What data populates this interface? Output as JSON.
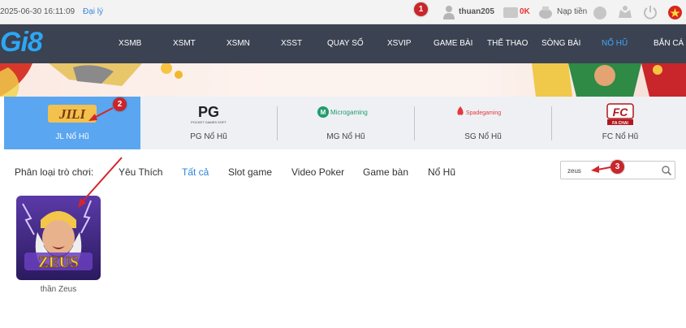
{
  "topbar": {
    "datetime": "2025-06-30 16:11:09",
    "lang_link": "Đại lý",
    "username": "thuan205",
    "balance": "0K",
    "deposit_label": "Nạp tiền",
    "icons": [
      "user-icon",
      "wallet-icon",
      "deposit-icon",
      "mail-icon",
      "vip-icon",
      "power-icon",
      "flag-icon"
    ]
  },
  "navbar": {
    "logo": "Gi8",
    "items": [
      {
        "label": "XSMB"
      },
      {
        "label": "XSMT"
      },
      {
        "label": "XSMN"
      },
      {
        "label": "XSST"
      },
      {
        "label": "QUAY SỐ"
      },
      {
        "label": "XSVIP"
      },
      {
        "label": "GAME BÀI"
      },
      {
        "label": "THỂ THAO"
      },
      {
        "label": "SÒNG BÀI"
      },
      {
        "label": "NỔ HŨ"
      },
      {
        "label": "BẮN CÁ"
      }
    ],
    "active": "NỔ HŨ",
    "active_color": "#41a8ff"
  },
  "providers": {
    "tabs": [
      {
        "logo": "JILI",
        "label": "JL Nổ Hũ"
      },
      {
        "logo": "PG",
        "logo_sub": "POCKET GAMES SOFT",
        "label": "PG Nổ Hũ"
      },
      {
        "logo": "Microgaming",
        "label": "MG Nổ Hũ"
      },
      {
        "logo": "Spadegaming",
        "label": "SG Nổ Hũ"
      },
      {
        "logo": "FC",
        "logo_sub": "FA CHAI",
        "label": "FC Nổ Hũ"
      }
    ],
    "active": "JL Nổ Hũ",
    "active_color": "#5aa6f0"
  },
  "filters": {
    "label": "Phân loại trò chơi:",
    "items": [
      {
        "label": "Yêu Thích"
      },
      {
        "label": "Tất cả"
      },
      {
        "label": "Slot game"
      },
      {
        "label": "Video Poker"
      },
      {
        "label": "Game bàn"
      },
      {
        "label": "Nổ Hũ"
      }
    ],
    "active": "Tất cả"
  },
  "search": {
    "value": "zeus"
  },
  "games": [
    {
      "name": "thần Zeus",
      "thumb_text": "ZEUS"
    }
  ],
  "annotations": [
    {
      "number": "1"
    },
    {
      "number": "2"
    },
    {
      "number": "3"
    }
  ],
  "colors": {
    "navbar_bg": "#3b4251",
    "marker": "#c8262b",
    "accent": "#2f85d8"
  }
}
